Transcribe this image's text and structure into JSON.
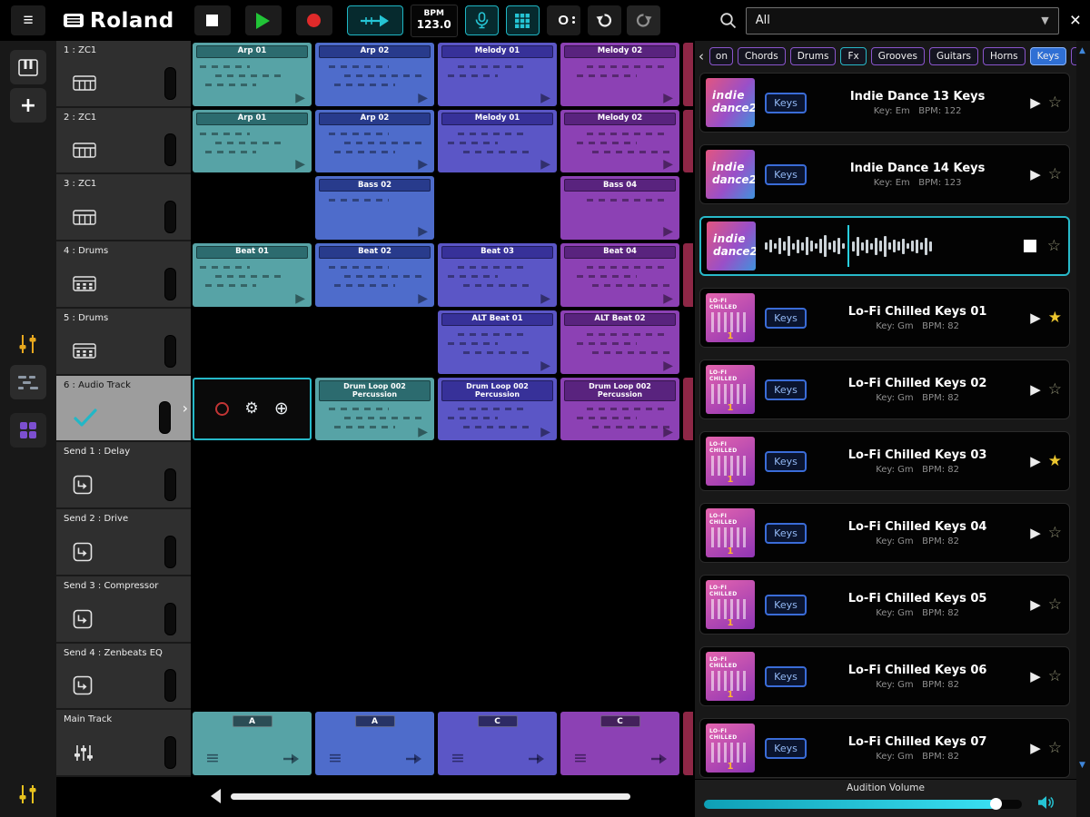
{
  "toolbar": {
    "brand": "Roland",
    "bpm_label": "BPM",
    "bpm_value": "123.0",
    "overdub_label": "O",
    "filter_value": "All"
  },
  "palette": {
    "teal": {
      "body": "#57A3A6",
      "head": "#2C6B6F"
    },
    "blue": {
      "body": "#4E6CCB",
      "head": "#283B8C"
    },
    "violet": {
      "body": "#5B56C6",
      "head": "#373199"
    },
    "purple": {
      "body": "#8C41B4",
      "head": "#59237E"
    },
    "red": {
      "body": "#8E2746",
      "head": "#5A1830"
    },
    "accent": "#28B9C9",
    "star": "#ECC62E"
  },
  "tracks": [
    {
      "label": "1 : ZC1",
      "icon": "keys"
    },
    {
      "label": "2 : ZC1",
      "icon": "keys"
    },
    {
      "label": "3 : ZC1",
      "icon": "keys"
    },
    {
      "label": "4 : Drums",
      "icon": "drums"
    },
    {
      "label": "5 : Drums",
      "icon": "drums"
    },
    {
      "label": "6 : Audio Track",
      "icon": "audio",
      "selected": true
    },
    {
      "label": "Send 1 : Delay",
      "icon": "send"
    },
    {
      "label": "Send 2 : Drive",
      "icon": "send"
    },
    {
      "label": "Send 3 : Compressor",
      "icon": "send"
    },
    {
      "label": "Send 4 : Zenbeats EQ",
      "icon": "send"
    },
    {
      "label": "Main Track",
      "icon": "main"
    }
  ],
  "grid_rows": [
    {
      "clips": [
        {
          "col": 0,
          "title": "Arp 01",
          "color": "teal",
          "pattern": "arp"
        },
        {
          "col": 1,
          "title": "Arp 02",
          "color": "blue",
          "pattern": "arp"
        },
        {
          "col": 2,
          "title": "Melody 01",
          "color": "violet",
          "pattern": "melody"
        },
        {
          "col": 3,
          "title": "Melody 02",
          "color": "purple",
          "pattern": "melody"
        },
        {
          "col": 4,
          "color": "red",
          "partial": true
        }
      ]
    },
    {
      "clips": [
        {
          "col": 0,
          "title": "Arp 01",
          "color": "teal",
          "pattern": "roll"
        },
        {
          "col": 1,
          "title": "Arp 02",
          "color": "blue",
          "pattern": "roll"
        },
        {
          "col": 2,
          "title": "Melody 01",
          "color": "violet",
          "pattern": "roll"
        },
        {
          "col": 3,
          "title": "Melody 02",
          "color": "purple",
          "pattern": "roll"
        },
        {
          "col": 4,
          "color": "red",
          "partial": true
        }
      ]
    },
    {
      "clips": [
        {
          "col": 1,
          "title": "Bass 02",
          "color": "blue",
          "pattern": "bass"
        },
        {
          "col": 3,
          "title": "Bass 04",
          "color": "purple",
          "pattern": "bass"
        }
      ]
    },
    {
      "clips": [
        {
          "col": 0,
          "title": "Beat 01",
          "color": "teal",
          "pattern": "beat"
        },
        {
          "col": 1,
          "title": "Beat 02",
          "color": "blue",
          "pattern": "beat"
        },
        {
          "col": 2,
          "title": "Beat 03",
          "color": "violet",
          "pattern": "beat"
        },
        {
          "col": 3,
          "title": "Beat 04",
          "color": "purple",
          "pattern": "beat"
        },
        {
          "col": 4,
          "color": "red",
          "partial": true
        }
      ]
    },
    {
      "clips": [
        {
          "col": 2,
          "title": "ALT Beat 01",
          "color": "violet",
          "pattern": "beat"
        },
        {
          "col": 3,
          "title": "ALT Beat 02",
          "color": "purple",
          "pattern": "beat"
        }
      ]
    },
    {
      "clips": [
        {
          "col": 0,
          "armed": true
        },
        {
          "col": 1,
          "title": "Drum Loop 002",
          "subtitle": "Percussion",
          "color": "teal",
          "pattern": "loop"
        },
        {
          "col": 2,
          "title": "Drum Loop 002",
          "subtitle": "Percussion",
          "color": "violet",
          "pattern": "loop"
        },
        {
          "col": 3,
          "title": "Drum Loop 002",
          "subtitle": "Percussion",
          "color": "purple",
          "pattern": "loop"
        },
        {
          "col": 4,
          "color": "red",
          "partial": true
        }
      ]
    },
    {
      "clips": []
    },
    {
      "clips": []
    },
    {
      "clips": []
    },
    {
      "clips": []
    },
    {
      "scene": true,
      "clips": [
        {
          "col": 0,
          "title": "A",
          "color": "teal"
        },
        {
          "col": 1,
          "title": "A",
          "color": "blue"
        },
        {
          "col": 2,
          "title": "C",
          "color": "violet"
        },
        {
          "col": 3,
          "title": "C",
          "color": "purple"
        },
        {
          "col": 4,
          "color": "red",
          "partial": true
        }
      ]
    }
  ],
  "browser": {
    "categories": [
      {
        "label": "on",
        "partial": true
      },
      {
        "label": "Chords"
      },
      {
        "label": "Drums"
      },
      {
        "label": "Fx",
        "accent": "teal"
      },
      {
        "label": "Grooves"
      },
      {
        "label": "Guitars"
      },
      {
        "label": "Horns"
      },
      {
        "label": "Keys",
        "selected": true
      },
      {
        "label": "Leads"
      }
    ],
    "art_text": {
      "indie_line1": "indie",
      "indie_line2": "dance2",
      "lofi_line1": "LO-FI CHILLED",
      "lofi_num": "1"
    },
    "items": [
      {
        "art": "indie",
        "chip": "Keys",
        "title": "Indie Dance 13 Keys",
        "meta": "Key: Em   BPM: 122",
        "starred": false
      },
      {
        "art": "indie",
        "chip": "Keys",
        "title": "Indie Dance 14 Keys",
        "meta": "Key: Em   BPM: 123",
        "starred": false
      },
      {
        "art": "indie",
        "playing": true,
        "starred": false
      },
      {
        "art": "lofi",
        "chip": "Keys",
        "title": "Lo-Fi Chilled Keys 01",
        "meta": "Key: Gm   BPM: 82",
        "starred": true
      },
      {
        "art": "lofi",
        "chip": "Keys",
        "title": "Lo-Fi Chilled Keys 02",
        "meta": "Key: Gm   BPM: 82",
        "starred": false
      },
      {
        "art": "lofi",
        "chip": "Keys",
        "title": "Lo-Fi Chilled Keys 03",
        "meta": "Key: Gm   BPM: 82",
        "starred": true
      },
      {
        "art": "lofi",
        "chip": "Keys",
        "title": "Lo-Fi Chilled Keys 04",
        "meta": "Key: Gm   BPM: 82",
        "starred": false
      },
      {
        "art": "lofi",
        "chip": "Keys",
        "title": "Lo-Fi Chilled Keys 05",
        "meta": "Key: Gm   BPM: 82",
        "starred": false
      },
      {
        "art": "lofi",
        "chip": "Keys",
        "title": "Lo-Fi Chilled Keys 06",
        "meta": "Key: Gm   BPM: 82",
        "starred": false
      },
      {
        "art": "lofi",
        "chip": "Keys",
        "title": "Lo-Fi Chilled Keys 07",
        "meta": "Key: Gm   BPM: 82",
        "starred": false
      }
    ],
    "audition_label": "Audition Volume"
  }
}
